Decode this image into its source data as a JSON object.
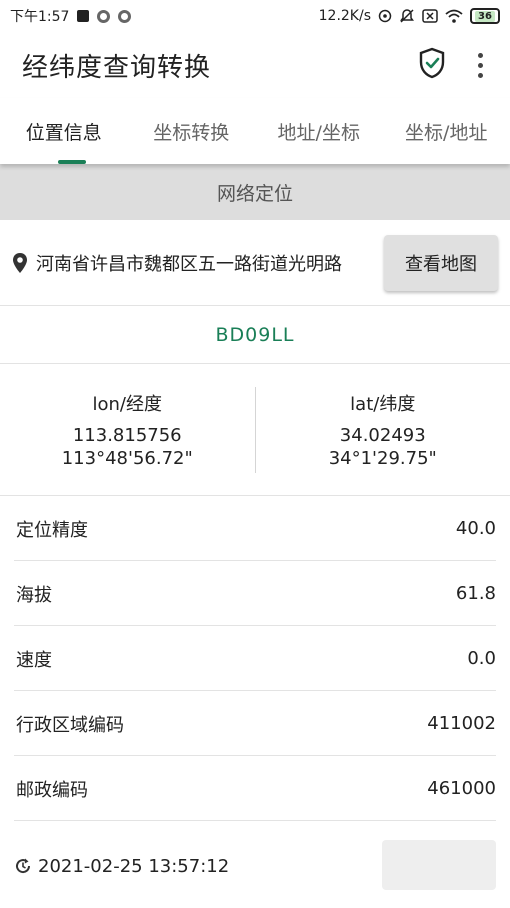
{
  "status": {
    "time": "下午1:57",
    "speed": "12.2K/s",
    "battery": "36"
  },
  "app": {
    "title": "经纬度查询转换"
  },
  "tabs": [
    {
      "label": "位置信息",
      "active": true
    },
    {
      "label": "坐标转换"
    },
    {
      "label": "地址/坐标"
    },
    {
      "label": "坐标/地址"
    }
  ],
  "location": {
    "mode": "网络定位",
    "address": "河南省许昌市魏都区五一路街道光明路",
    "map_button": "查看地图",
    "coord_type": "BD09LL"
  },
  "coords": {
    "lon_label": "lon/经度",
    "lon_decimal": "113.815756",
    "lon_dms": "113°48'56.72\"",
    "lat_label": "lat/纬度",
    "lat_decimal": "34.02493",
    "lat_dms": "34°1'29.75\""
  },
  "info": [
    {
      "label": "定位精度",
      "value": "40.0"
    },
    {
      "label": "海拔",
      "value": "61.8"
    },
    {
      "label": "速度",
      "value": "0.0"
    },
    {
      "label": "行政区域编码",
      "value": "411002"
    },
    {
      "label": "邮政编码",
      "value": "461000"
    }
  ],
  "timestamp": "2021-02-25 13:57:12",
  "colors": {
    "accent": "#1a7f57",
    "band": "#dddddd"
  }
}
